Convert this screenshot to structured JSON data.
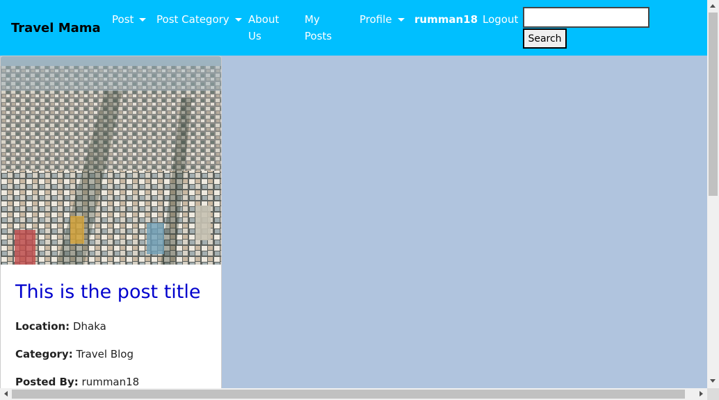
{
  "navbar": {
    "brand": "Travel Mama",
    "post_label": "Post",
    "post_category_label": "Post Category",
    "about_label": "About Us",
    "my_posts_label": "My Posts",
    "profile_label": "Profile",
    "username": "rumman18",
    "logout_label": "Logout",
    "search": {
      "value": "",
      "placeholder": "",
      "button_label": "Search"
    }
  },
  "colors": {
    "navbar_bg": "#00bfff",
    "page_bg": "#b0c4de",
    "title_color": "#0000cd"
  },
  "post": {
    "image_icon": "city-aerial-photo",
    "title": "This is the post title",
    "location_label": "Location:",
    "location_value": "Dhaka",
    "category_label": "Category:",
    "category_value": "Travel Blog",
    "posted_by_label": "Posted By:",
    "posted_by_value": "rumman18"
  }
}
